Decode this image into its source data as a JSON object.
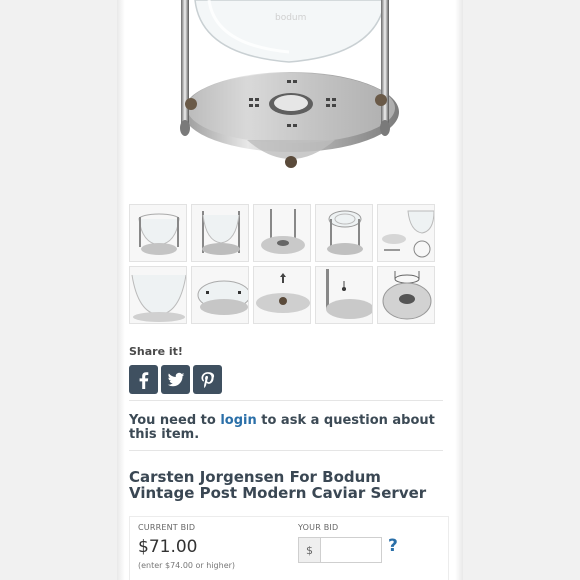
{
  "share": {
    "title": "Share it!",
    "icons": [
      "facebook-icon",
      "twitter-icon",
      "pinterest-icon"
    ]
  },
  "question": {
    "prefix": "You need to ",
    "link": "login",
    "suffix": " to ask a question about this item."
  },
  "item": {
    "title": "Carsten Jorgensen For Bodum Vintage Post Modern Caviar Server"
  },
  "bid": {
    "current_label": "CURRENT BID",
    "current_amount": "$71.00",
    "note": "(enter $74.00 or higher)",
    "your_label": "YOUR BID",
    "currency_symbol": "$",
    "input_value": "",
    "help": "?"
  },
  "colors": {
    "share_bg": "#3f5060",
    "link": "#2a6fa8",
    "heading": "#3a4753"
  }
}
